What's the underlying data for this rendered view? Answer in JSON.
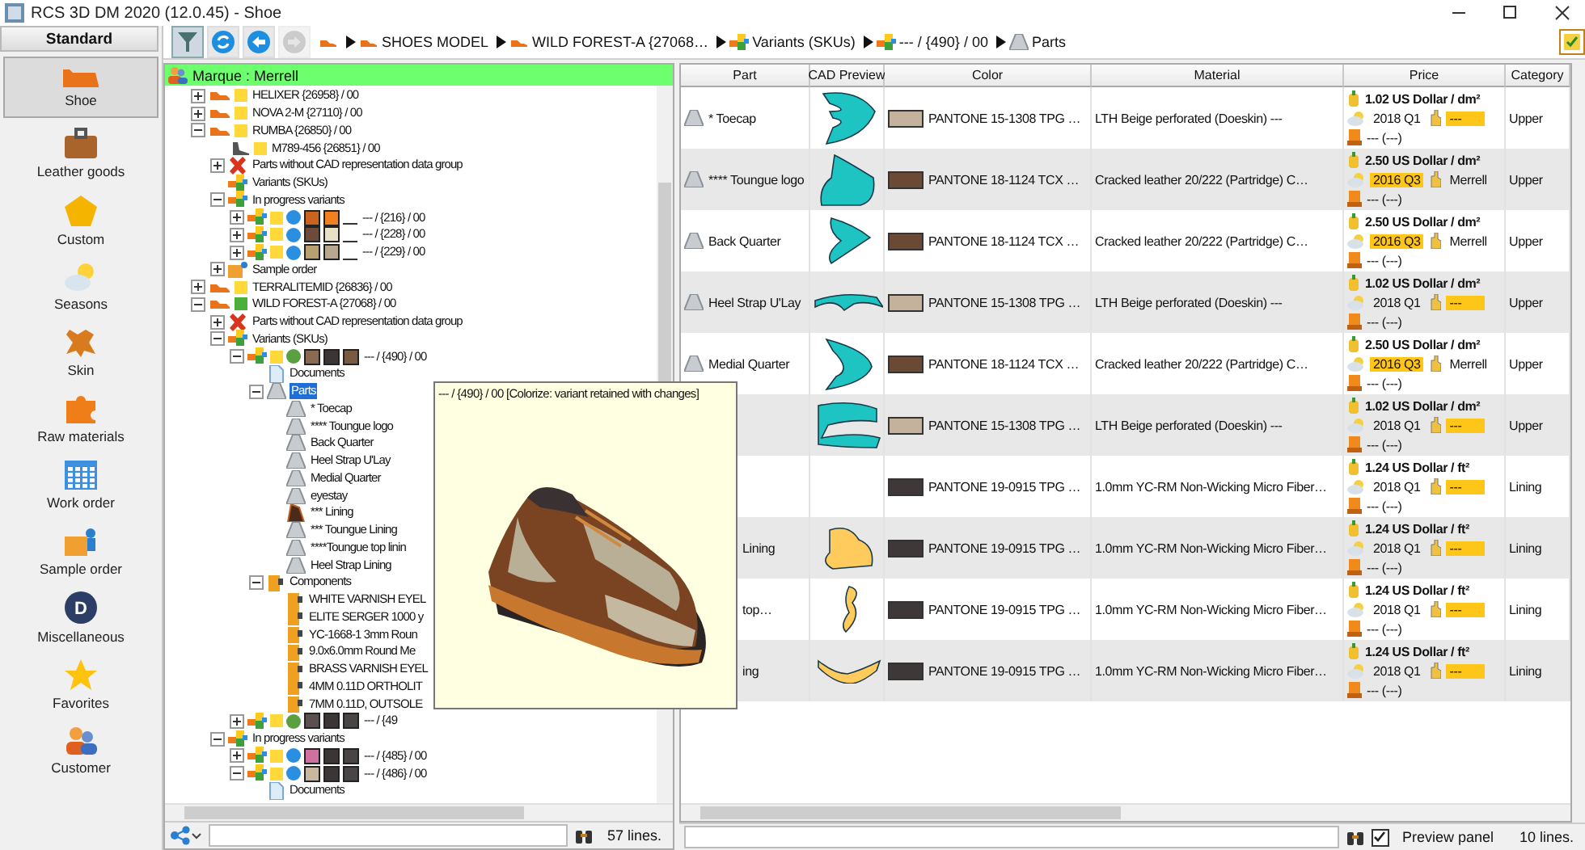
{
  "window": {
    "title": "RCS 3D DM 2020 (12.0.45) - Shoe"
  },
  "sidebar": {
    "header": "Standard",
    "items": [
      {
        "label": "Shoe",
        "kind": "shoe",
        "selected": true
      },
      {
        "label": "Leather goods",
        "kind": "bag",
        "selected": false
      },
      {
        "label": "Custom",
        "kind": "pentagon",
        "selected": false
      },
      {
        "label": "Seasons",
        "kind": "seasons",
        "selected": false
      },
      {
        "label": "Skin",
        "kind": "hide",
        "selected": false
      },
      {
        "label": "Raw materials",
        "kind": "puzzle",
        "selected": false
      },
      {
        "label": "Work order",
        "kind": "calendar",
        "selected": false
      },
      {
        "label": "Sample order",
        "kind": "sample",
        "selected": false
      },
      {
        "label": "Miscellaneous",
        "kind": "letter",
        "badge": "D",
        "selected": false
      },
      {
        "label": "Favorites",
        "kind": "star",
        "selected": false
      },
      {
        "label": "Customer",
        "kind": "people",
        "selected": false
      }
    ]
  },
  "toolbar": {
    "buttons": [
      {
        "kind": "filter",
        "pressed": true,
        "disabled": false
      },
      {
        "kind": "refresh",
        "pressed": false,
        "disabled": false
      },
      {
        "kind": "back",
        "pressed": false,
        "disabled": false
      },
      {
        "kind": "forward",
        "pressed": false,
        "disabled": true
      }
    ],
    "breadcrumb": [
      {
        "kind": "shoe"
      },
      {
        "kind": "shoe",
        "label": "SHOES MODEL"
      },
      {
        "kind": "shoe",
        "label": "WILD FOREST-A {27068…"
      },
      {
        "kind": "variants",
        "label": "Variants (SKUs)"
      },
      {
        "kind": "variants",
        "label": "--- / {490} / 00"
      },
      {
        "kind": "part",
        "label": "Parts"
      }
    ]
  },
  "tree": {
    "header": "Marque : Merrell",
    "items": [
      {
        "label": "HELIXER {26958} / 00",
        "kind": "shoe",
        "color": "#ffd83a",
        "expanded": false,
        "selected": false
      },
      {
        "label": "NOVA 2-M {27110} / 00",
        "kind": "shoe",
        "color": "#ffd83a",
        "expanded": false,
        "selected": false
      },
      {
        "label": "RUMBA {26850} / 00",
        "kind": "shoe",
        "color": "#ffd83a",
        "expanded": true,
        "selected": false,
        "children": [
          {
            "label": "M789-456 {26851} / 00",
            "kind": "boot",
            "color": "#ffd83a",
            "selected": false
          },
          {
            "label": "Parts without CAD representation data group",
            "kind": "error",
            "expanded": false,
            "selected": false
          },
          {
            "label": "Variants (SKUs)",
            "kind": "variants",
            "selected": false
          },
          {
            "label": "In progress variants",
            "kind": "variants",
            "expanded": true,
            "selected": false,
            "children": [
              {
                "label": "--- / {216} / 00",
                "kind": "variants",
                "color": "#ffd83a",
                "marker": {
                  "color": "#2a8fe0"
                },
                "swatches": [
                  {
                    "color": "#c8641e"
                  },
                  {
                    "color": "#f08020"
                  }
                ],
                "empty_slot": true,
                "expanded": false,
                "selected": false
              },
              {
                "label": "--- / {228} / 00",
                "kind": "variants",
                "color": "#ffd83a",
                "marker": {
                  "color": "#2a8fe0"
                },
                "swatches": [
                  {
                    "color": "#6e4a3a"
                  },
                  {
                    "color": "#e9e0c8"
                  }
                ],
                "empty_slot": true,
                "expanded": false,
                "selected": false
              },
              {
                "label": "--- / {229} / 00",
                "kind": "variants",
                "color": "#ffd83a",
                "marker": {
                  "color": "#2a8fe0"
                },
                "swatches": [
                  {
                    "color": "#b8a070"
                  },
                  {
                    "color": "#b8a890"
                  }
                ],
                "empty_slot": true,
                "expanded": false,
                "selected": false
              }
            ]
          },
          {
            "label": "Sample order",
            "kind": "sample",
            "expanded": false,
            "selected": false
          }
        ]
      },
      {
        "label": "TERRALITEMID {26836} / 00",
        "kind": "shoe",
        "color": "#ffd83a",
        "expanded": false,
        "selected": false
      },
      {
        "label": "WILD FOREST-A {27068} / 00",
        "kind": "shoe",
        "color": "#4caf3a",
        "expanded": true,
        "selected": false,
        "children": [
          {
            "label": "Parts without CAD representation data group",
            "kind": "error",
            "expanded": false,
            "selected": false
          },
          {
            "label": "Variants (SKUs)",
            "kind": "variants",
            "expanded": true,
            "selected": false,
            "children": [
              {
                "label": "--- / {490} / 00",
                "kind": "variants",
                "color": "#ffd83a",
                "marker": {
                  "color": "#5aa040"
                },
                "swatches": [
                  {
                    "color": "#8a6a50"
                  },
                  {
                    "color": "#3c3535"
                  },
                  {
                    "color": "#7a5a40"
                  }
                ],
                "expanded": true,
                "selected": false,
                "children": [
                  {
                    "label": "Documents",
                    "kind": "document",
                    "selected": false
                  },
                  {
                    "label": "Parts",
                    "kind": "part",
                    "expanded": true,
                    "selected": true,
                    "children": [
                      {
                        "label": "* Toecap",
                        "kind": "part",
                        "selected": false
                      },
                      {
                        "label": "**** Toungue logo",
                        "kind": "part",
                        "selected": false
                      },
                      {
                        "label": "Back Quarter",
                        "kind": "part",
                        "selected": false
                      },
                      {
                        "label": "Heel Strap U'Lay",
                        "kind": "part",
                        "selected": false
                      },
                      {
                        "label": "Medial Quarter",
                        "kind": "part",
                        "selected": false
                      },
                      {
                        "label": "eyestay",
                        "kind": "part",
                        "selected": false
                      },
                      {
                        "label": "*** Lining",
                        "kind": "lining",
                        "selected": false
                      },
                      {
                        "label": "*** Toungue Lining",
                        "kind": "part",
                        "selected": false
                      },
                      {
                        "label": "****Toungue top linin",
                        "kind": "part",
                        "selected": false
                      },
                      {
                        "label": "Heel Strap Lining",
                        "kind": "part",
                        "selected": false
                      }
                    ]
                  },
                  {
                    "label": "Components",
                    "kind": "components",
                    "expanded": true,
                    "selected": false,
                    "children": [
                      {
                        "label": "WHITE VARNISH EYEL",
                        "kind": "components",
                        "selected": false
                      },
                      {
                        "label": "ELITE SERGER 1000 y",
                        "kind": "components",
                        "selected": false
                      },
                      {
                        "label": "YC-1668-1 3mm Roun",
                        "kind": "components",
                        "selected": false
                      },
                      {
                        "label": "9.0x6.0mm Round Me",
                        "kind": "components",
                        "selected": false
                      },
                      {
                        "label": "BRASS VARNISH EYEL",
                        "kind": "components",
                        "selected": false
                      },
                      {
                        "label": "4MM 0.11D ORTHOLIT",
                        "kind": "components",
                        "selected": false
                      },
                      {
                        "label": "7MM 0.11D, OUTSOLE",
                        "kind": "components",
                        "selected": false
                      }
                    ]
                  }
                ]
              },
              {
                "label": "--- / {49",
                "kind": "variants",
                "color": "#ffd83a",
                "marker": {
                  "color": "#5aa040"
                },
                "swatches": [
                  {
                    "color": "#5a5050"
                  },
                  {
                    "color": "#3c3535"
                  },
                  {
                    "color": "#4a4545"
                  }
                ],
                "expanded": false,
                "selected": false
              }
            ]
          },
          {
            "label": "In progress variants",
            "kind": "variants",
            "expanded": true,
            "selected": false,
            "children": [
              {
                "label": "--- / {485} / 00",
                "kind": "variants",
                "color": "#ffd83a",
                "marker": {
                  "color": "#2a8fe0"
                },
                "swatches": [
                  {
                    "color": "#d070a0"
                  },
                  {
                    "color": "#3c3535"
                  },
                  {
                    "color": "#4a4545"
                  }
                ],
                "expanded": false,
                "selected": false
              },
              {
                "label": "--- / {486} / 00",
                "kind": "variants",
                "color": "#ffd83a",
                "marker": {
                  "color": "#2a8fe0"
                },
                "swatches": [
                  {
                    "color": "#c8b8a0"
                  },
                  {
                    "color": "#3c3535"
                  },
                  {
                    "color": "#4a4545"
                  }
                ],
                "expanded": true,
                "selected": false,
                "children": [
                  {
                    "label": "Documents",
                    "kind": "document",
                    "selected": false
                  }
                ]
              }
            ]
          }
        ]
      }
    ],
    "status": {
      "lines": "57 lines."
    }
  },
  "table": {
    "columns": [
      "Part",
      "CAD Preview",
      "Color",
      "Material",
      "Price",
      "Category"
    ],
    "rows": [
      {
        "part": "* Toecap",
        "covered": false,
        "kind": "upper",
        "swatch": {
          "color": "#c4b29c"
        },
        "color_name": "PANTONE 15-1308 TPG …",
        "material": "LTH Beige perforated   (Doeskin) ---",
        "price": "1.02 US Dollar / dm²",
        "season": "2018 Q1",
        "season_flagged": false,
        "supplier": "---",
        "supplier_flagged": true,
        "origin": "--- (---)",
        "category": "Upper"
      },
      {
        "part": "**** Toungue logo",
        "covered": false,
        "kind": "upper",
        "swatch": {
          "color": "#6b4a35"
        },
        "color_name": "PANTONE 18-1124 TCX …",
        "material": "Cracked leather 20/222   (Partridge) C…",
        "price": "2.50 US Dollar / dm²",
        "season": "2016 Q3",
        "season_flagged": true,
        "supplier": "Merrell",
        "supplier_flagged": false,
        "origin": "--- (---)",
        "category": "Upper"
      },
      {
        "part": "Back Quarter",
        "covered": false,
        "kind": "upper",
        "swatch": {
          "color": "#6b4a35"
        },
        "color_name": "PANTONE 18-1124 TCX …",
        "material": "Cracked leather 20/222   (Partridge) C…",
        "price": "2.50 US Dollar / dm²",
        "season": "2016 Q3",
        "season_flagged": true,
        "supplier": "Merrell",
        "supplier_flagged": false,
        "origin": "--- (---)",
        "category": "Upper"
      },
      {
        "part": "Heel Strap U'Lay",
        "covered": false,
        "kind": "upper",
        "swatch": {
          "color": "#c4b29c"
        },
        "color_name": "PANTONE 15-1308 TPG …",
        "material": "LTH Beige perforated   (Doeskin) ---",
        "price": "1.02 US Dollar / dm²",
        "season": "2018 Q1",
        "season_flagged": false,
        "supplier": "---",
        "supplier_flagged": true,
        "origin": "--- (---)",
        "category": "Upper"
      },
      {
        "part": "Medial Quarter",
        "covered": false,
        "kind": "upper",
        "swatch": {
          "color": "#6b4a35"
        },
        "color_name": "PANTONE 18-1124 TCX …",
        "material": "Cracked leather 20/222   (Partridge) C…",
        "price": "2.50 US Dollar / dm²",
        "season": "2016 Q3",
        "season_flagged": true,
        "supplier": "Merrell",
        "supplier_flagged": false,
        "origin": "--- (---)",
        "category": "Upper"
      },
      {
        "covered": true,
        "kind": "upper",
        "swatch": {
          "color": "#c4b29c"
        },
        "color_name": "PANTONE 15-1308 TPG …",
        "material": "LTH Beige perforated   (Doeskin) ---",
        "price": "1.02 US Dollar / dm²",
        "season": "2018 Q1",
        "season_flagged": false,
        "supplier": "---",
        "supplier_flagged": true,
        "origin": "--- (---)",
        "category": "Upper"
      },
      {
        "covered": true,
        "kind": "plain",
        "swatch": {
          "color": "#3e3838"
        },
        "color_name": "PANTONE 19-0915 TPG …",
        "material": "1.0mm YC-RM Non-Wicking Micro Fiber…",
        "price": "1.24 US Dollar / ft²",
        "season": "2018 Q1",
        "season_flagged": false,
        "supplier": "---",
        "supplier_flagged": true,
        "origin": "--- (---)",
        "category": "Lining"
      },
      {
        "part": "Lining",
        "covered": true,
        "kind": "lining",
        "swatch": {
          "color": "#3e3838"
        },
        "color_name": "PANTONE 19-0915 TPG …",
        "material": "1.0mm YC-RM Non-Wicking Micro Fiber…",
        "price": "1.24 US Dollar / ft²",
        "season": "2018 Q1",
        "season_flagged": false,
        "supplier": "---",
        "supplier_flagged": true,
        "origin": "--- (---)",
        "category": "Lining"
      },
      {
        "part": "top…",
        "covered": true,
        "kind": "lining",
        "swatch": {
          "color": "#3e3838"
        },
        "color_name": "PANTONE 19-0915 TPG …",
        "material": "1.0mm YC-RM Non-Wicking Micro Fiber…",
        "price": "1.24 US Dollar / ft²",
        "season": "2018 Q1",
        "season_flagged": false,
        "supplier": "---",
        "supplier_flagged": true,
        "origin": "--- (---)",
        "category": "Lining"
      },
      {
        "part": "ing",
        "covered": true,
        "kind": "lining",
        "swatch": {
          "color": "#3e3838"
        },
        "color_name": "PANTONE 19-0915 TPG …",
        "material": "1.0mm YC-RM Non-Wicking Micro Fiber…",
        "price": "1.24 US Dollar / ft²",
        "season": "2018 Q1",
        "season_flagged": false,
        "supplier": "---",
        "supplier_flagged": true,
        "origin": "--- (---)",
        "category": "Lining"
      }
    ],
    "status": {
      "preview_panel": {
        "label": "Preview panel",
        "checked": true
      },
      "lines": "10 lines."
    }
  },
  "tooltip": {
    "text": "--- / {490} / 00 [Colorize: variant retained with changes]"
  }
}
